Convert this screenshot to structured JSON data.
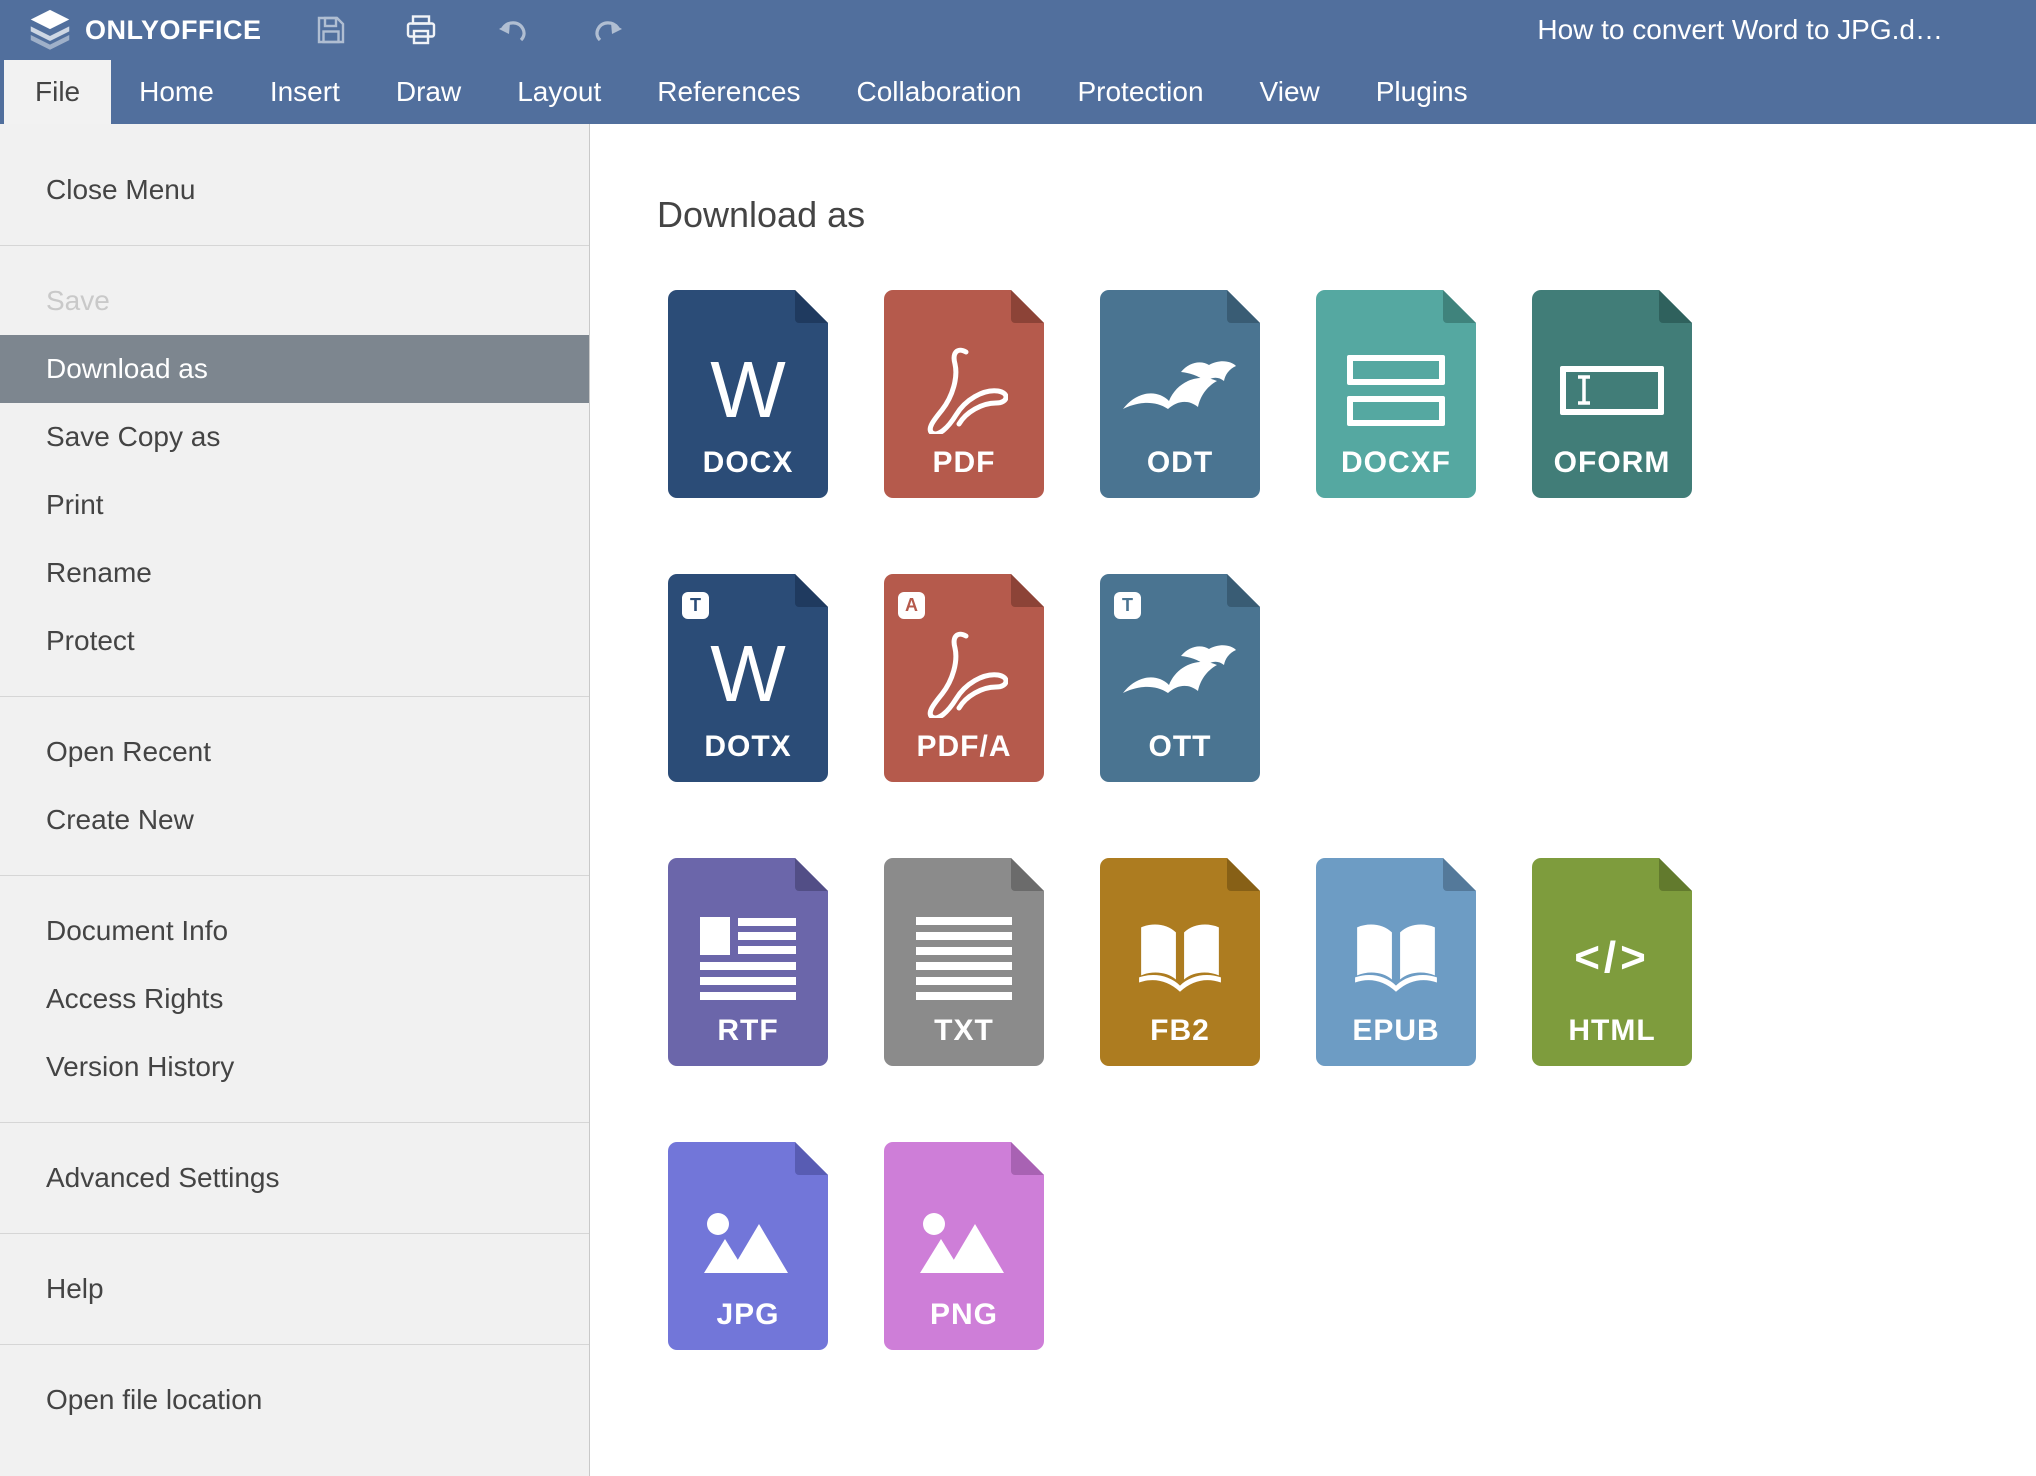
{
  "header": {
    "logo_text": "ONLYOFFICE",
    "document_title": "How to convert Word to JPG.d…",
    "toolbar": {
      "save": "save-icon",
      "print": "print-icon",
      "undo": "undo-icon",
      "redo": "redo-icon"
    }
  },
  "tabs": {
    "active": "File",
    "items": [
      "File",
      "Home",
      "Insert",
      "Draw",
      "Layout",
      "References",
      "Collaboration",
      "Protection",
      "View",
      "Plugins"
    ]
  },
  "sidebar": {
    "groups": [
      {
        "items": [
          {
            "label": "Close Menu",
            "state": "normal"
          }
        ]
      },
      {
        "items": [
          {
            "label": "Save",
            "state": "disabled"
          },
          {
            "label": "Download as",
            "state": "selected"
          },
          {
            "label": "Save Copy as",
            "state": "normal"
          },
          {
            "label": "Print",
            "state": "normal"
          },
          {
            "label": "Rename",
            "state": "normal"
          },
          {
            "label": "Protect",
            "state": "normal"
          }
        ]
      },
      {
        "items": [
          {
            "label": "Open Recent",
            "state": "normal"
          },
          {
            "label": "Create New",
            "state": "normal"
          }
        ]
      },
      {
        "items": [
          {
            "label": "Document Info",
            "state": "normal"
          },
          {
            "label": "Access Rights",
            "state": "normal"
          },
          {
            "label": "Version History",
            "state": "normal"
          }
        ]
      },
      {
        "items": [
          {
            "label": "Advanced Settings",
            "state": "normal"
          }
        ]
      },
      {
        "items": [
          {
            "label": "Help",
            "state": "normal"
          }
        ]
      },
      {
        "items": [
          {
            "label": "Open file location",
            "state": "normal"
          }
        ]
      }
    ]
  },
  "main": {
    "title": "Download as",
    "formats": [
      {
        "label": "DOCX",
        "color": "#2b4c77",
        "fold": "#1f3a5f",
        "glyph": "word-w",
        "glyph_letter": "W"
      },
      {
        "label": "PDF",
        "color": "#b55a4c",
        "fold": "#8c4337",
        "glyph": "acrobat"
      },
      {
        "label": "ODT",
        "color": "#4a7491",
        "fold": "#395c74",
        "glyph": "gulls"
      },
      {
        "label": "DOCXF",
        "color": "#55a8a1",
        "fold": "#3f837c",
        "glyph": "form-fields"
      },
      {
        "label": "OFORM",
        "color": "#417d78",
        "fold": "#2f615d",
        "glyph": "form-cursor"
      },
      {
        "label": "DOTX",
        "color": "#2b4c77",
        "fold": "#1f3a5f",
        "glyph": "word-w",
        "glyph_letter": "W",
        "badge": "T"
      },
      {
        "label": "PDF/A",
        "color": "#b55a4c",
        "fold": "#8c4337",
        "glyph": "acrobat",
        "badge": "A"
      },
      {
        "label": "OTT",
        "color": "#4a7491",
        "fold": "#395c74",
        "glyph": "gulls",
        "badge": "T"
      },
      {
        "label": "RTF",
        "color": "#6b66aa",
        "fold": "#524e86",
        "glyph": "rich-text-lines"
      },
      {
        "label": "TXT",
        "color": "#8b8b8b",
        "fold": "#6b6b6b",
        "glyph": "text-lines"
      },
      {
        "label": "FB2",
        "color": "#ad7c20",
        "fold": "#876016",
        "glyph": "open-book"
      },
      {
        "label": "EPUB",
        "color": "#6d9cc4",
        "fold": "#54799a",
        "glyph": "open-book"
      },
      {
        "label": "HTML",
        "color": "#7e9c3d",
        "fold": "#627a2d",
        "glyph": "code",
        "glyph_letter": "</>"
      },
      {
        "label": "JPG",
        "color": "#7276d9",
        "fold": "#585cb3",
        "glyph": "image"
      },
      {
        "label": "PNG",
        "color": "#ce7ed8",
        "fold": "#a862b3",
        "glyph": "image"
      }
    ]
  },
  "colors": {
    "header_bg": "#516f9d",
    "active_tab_bg": "#f2f2f2",
    "sidebar_bg": "#f1f1f1",
    "sidebar_selected_bg": "#7d868f",
    "sidebar_text": "#444444",
    "sidebar_disabled_text": "#c9c9c9",
    "main_bg": "#ffffff"
  }
}
